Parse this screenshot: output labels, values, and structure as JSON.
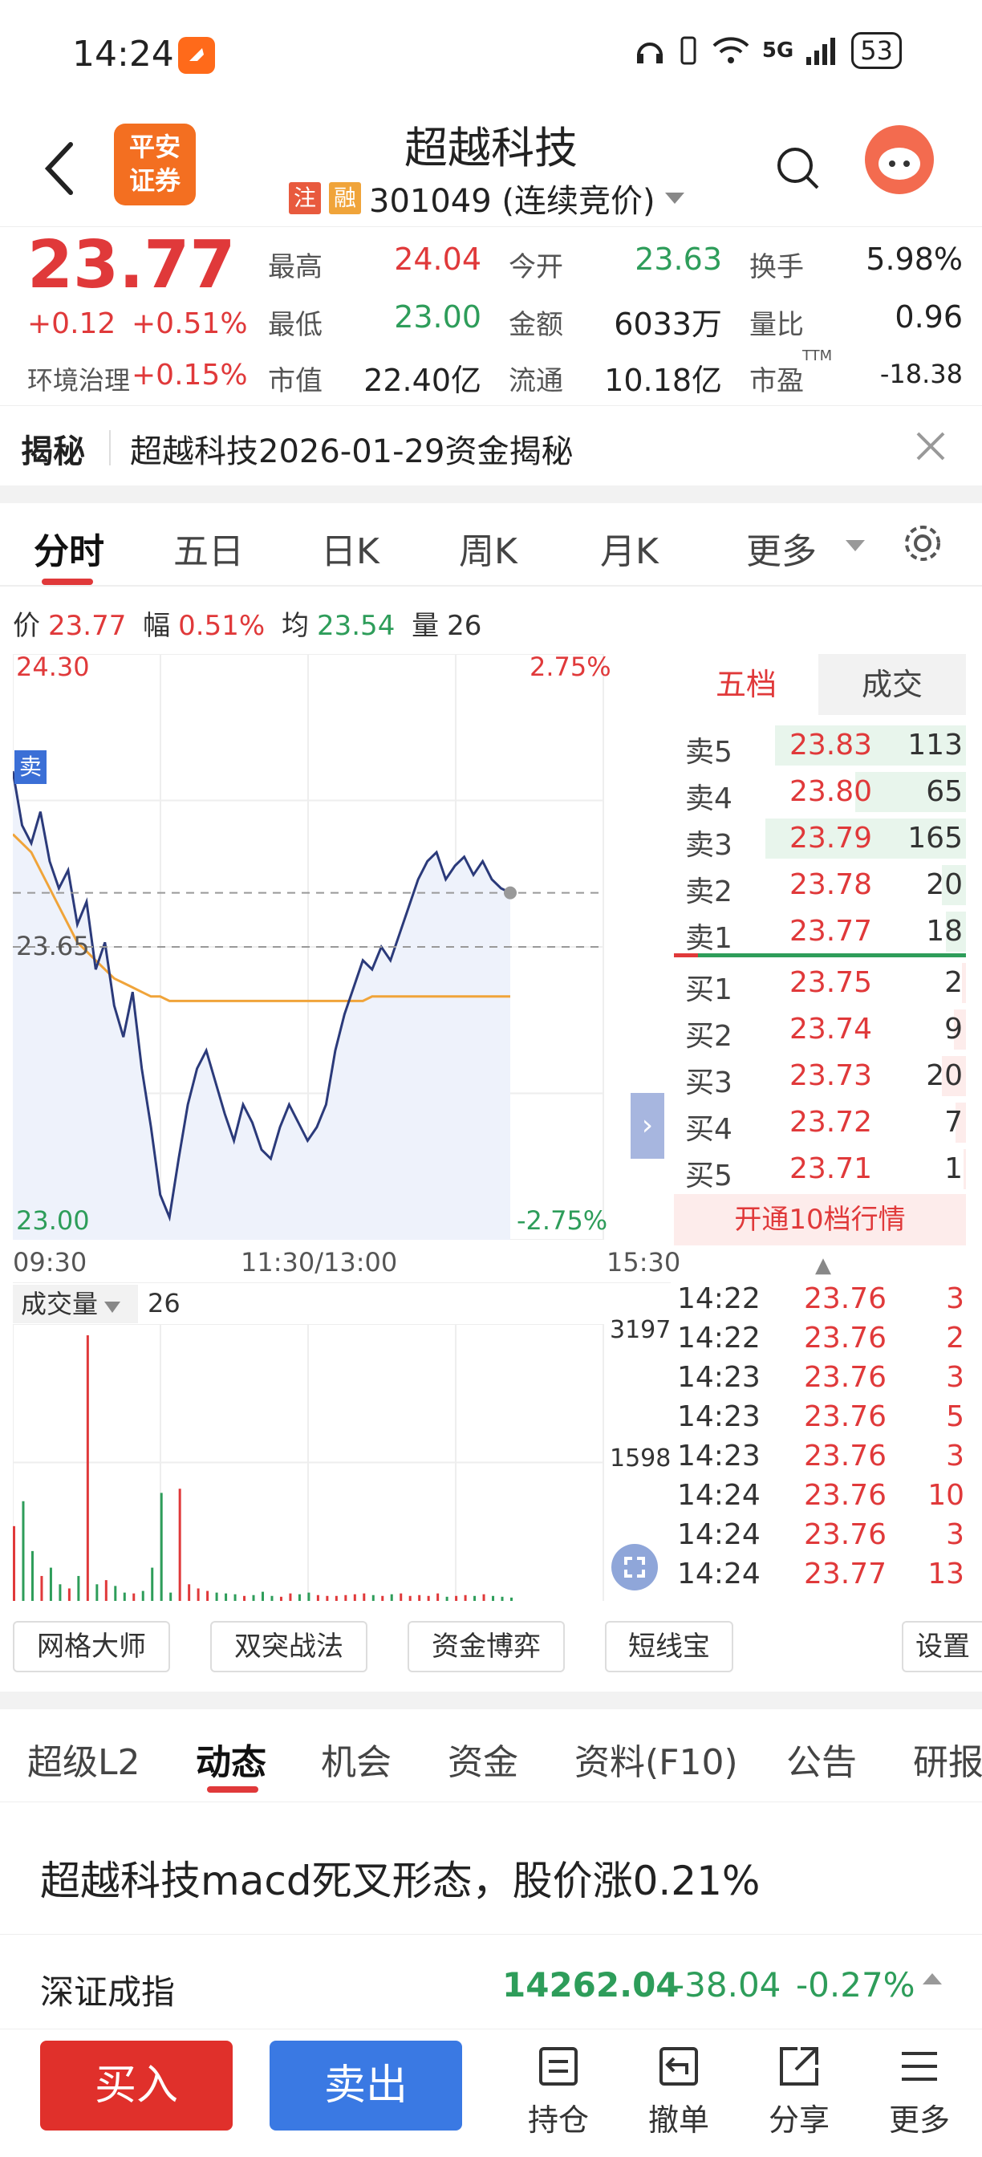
{
  "status": {
    "time": "14:24",
    "network": "5G",
    "battery": "53"
  },
  "header": {
    "title": "超越科技",
    "tag_zhu": "注",
    "tag_rong": "融",
    "code_text": "301049 (连续竞价)",
    "logo_text_1": "平安",
    "logo_text_2": "证券"
  },
  "quote": {
    "price": "23.77",
    "change": "+0.12",
    "change_pct": "+0.51%",
    "sector_name": "环境治理",
    "sector_pct": "+0.15%",
    "high_label": "最高",
    "high": "24.04",
    "open_label": "今开",
    "open": "23.63",
    "turnover_label": "换手",
    "turnover": "5.98%",
    "low_label": "最低",
    "low": "23.00",
    "amount_label": "金额",
    "amount": "6033万",
    "vol_ratio_label": "量比",
    "vol_ratio": "0.96",
    "mktcap_label": "市值",
    "mktcap": "22.40亿",
    "float_label": "流通",
    "float": "10.18亿",
    "pe_label": "市盈",
    "pe_sup": "TTM",
    "pe": "-18.38"
  },
  "reveal": {
    "label": "揭秘",
    "text": "超越科技2026-01-29资金揭秘"
  },
  "chart_tabs": [
    "分时",
    "五日",
    "日K",
    "周K",
    "月K",
    "更多"
  ],
  "info": {
    "price_label": "价",
    "price": "23.77",
    "amp_label": "幅",
    "amp": "0.51%",
    "avg_label": "均",
    "avg": "23.54",
    "vol_label": "量",
    "vol": "26"
  },
  "chart_data": {
    "type": "line",
    "title": "",
    "y_top": "24.30",
    "y_mid": "23.65",
    "y_bottom": "23.00",
    "pct_top": "2.75%",
    "pct_bottom": "-2.75%",
    "ylim": [
      23.0,
      24.3
    ],
    "x_ticks": [
      "09:30",
      "11:30/13:00",
      "15:30"
    ],
    "sell_marker": "卖",
    "series": [
      {
        "values": [
          24.04,
          23.92,
          23.88,
          23.95,
          23.84,
          23.78,
          23.82,
          23.7,
          23.75,
          23.6,
          23.66,
          23.52,
          23.45,
          23.55,
          23.38,
          23.25,
          23.1,
          23.05,
          23.18,
          23.3,
          23.38,
          23.42,
          23.35,
          23.28,
          23.22,
          23.3,
          23.26,
          23.2,
          23.18,
          23.25,
          23.3,
          23.26,
          23.22,
          23.25,
          23.3,
          23.42,
          23.5,
          23.56,
          23.62,
          23.6,
          23.65,
          23.62,
          23.68,
          23.74,
          23.8,
          23.84,
          23.86,
          23.8,
          23.83,
          23.85,
          23.81,
          23.84,
          23.8,
          23.78,
          23.77
        ]
      },
      {
        "values": [
          23.9,
          23.88,
          23.86,
          23.82,
          23.78,
          23.74,
          23.7,
          23.66,
          23.64,
          23.62,
          23.6,
          23.58,
          23.57,
          23.56,
          23.55,
          23.54,
          23.54,
          23.53,
          23.53,
          23.53,
          23.53,
          23.53,
          23.53,
          23.53,
          23.53,
          23.53,
          23.53,
          23.53,
          23.53,
          23.53,
          23.53,
          23.53,
          23.53,
          23.53,
          23.53,
          23.53,
          23.53,
          23.53,
          23.53,
          23.54,
          23.54,
          23.54,
          23.54,
          23.54,
          23.54,
          23.54,
          23.54,
          23.54,
          23.54,
          23.54,
          23.54,
          23.54,
          23.54,
          23.54,
          23.54
        ]
      }
    ],
    "volume_max": "3197",
    "volume_mid": "1598",
    "volume_values": [
      900,
      1200,
      600,
      300,
      400,
      200,
      150,
      300,
      3197,
      200,
      250,
      180,
      100,
      90,
      120,
      400,
      1300,
      100,
      1350,
      200,
      150,
      120,
      100,
      90,
      80,
      60,
      70,
      110,
      60,
      50,
      90,
      80,
      100,
      70,
      60,
      60,
      70,
      80,
      90,
      70,
      60,
      80,
      90,
      60,
      70,
      60,
      90,
      50,
      60,
      70,
      60,
      80,
      60,
      50,
      40
    ]
  },
  "orderbook": {
    "tab_5": "五档",
    "tab_trades": "成交",
    "asks": [
      {
        "label": "卖5",
        "price": "23.83",
        "vol": "113",
        "bar": 0.95
      },
      {
        "label": "卖4",
        "price": "23.80",
        "vol": "65",
        "bar": 0.55
      },
      {
        "label": "卖3",
        "price": "23.79",
        "vol": "165",
        "bar": 1.0
      },
      {
        "label": "卖2",
        "price": "23.78",
        "vol": "20",
        "bar": 0.12
      },
      {
        "label": "卖1",
        "price": "23.77",
        "vol": "18",
        "bar": 0.1
      }
    ],
    "bids": [
      {
        "label": "买1",
        "price": "23.75",
        "vol": "2",
        "bar": 0.02
      },
      {
        "label": "买2",
        "price": "23.74",
        "vol": "9",
        "bar": 0.06
      },
      {
        "label": "买3",
        "price": "23.73",
        "vol": "20",
        "bar": 0.12
      },
      {
        "label": "买4",
        "price": "23.72",
        "vol": "7",
        "bar": 0.05
      },
      {
        "label": "买5",
        "price": "23.71",
        "vol": "1",
        "bar": 0.01
      }
    ],
    "open10": "开通10档行情"
  },
  "volume_header": {
    "label": "成交量",
    "value": "26"
  },
  "ticks": [
    {
      "time": "14:22",
      "price": "23.76",
      "vol": "3"
    },
    {
      "time": "14:22",
      "price": "23.76",
      "vol": "2"
    },
    {
      "time": "14:23",
      "price": "23.76",
      "vol": "3"
    },
    {
      "time": "14:23",
      "price": "23.76",
      "vol": "5"
    },
    {
      "time": "14:23",
      "price": "23.76",
      "vol": "3"
    },
    {
      "time": "14:24",
      "price": "23.76",
      "vol": "10"
    },
    {
      "time": "14:24",
      "price": "23.76",
      "vol": "3"
    },
    {
      "time": "14:24",
      "price": "23.77",
      "vol": "13"
    }
  ],
  "tools": [
    "网格大师",
    "双突战法",
    "资金博弈",
    "短线宝",
    "设置"
  ],
  "bottom_tabs": [
    "超级L2",
    "动态",
    "机会",
    "资金",
    "资料(F10)",
    "公告",
    "研报"
  ],
  "news": {
    "title": "超越科技macd死叉形态，股价涨0.21%"
  },
  "index": {
    "name": "深证成指",
    "value": "14262.04",
    "change": "-38.04",
    "pct": "-0.27%"
  },
  "bottom_bar": {
    "buy": "买入",
    "sell": "卖出",
    "hold": "持仓",
    "cancel": "撤单",
    "share": "分享",
    "more": "更多"
  },
  "colors": {
    "up": "#e0393a",
    "down": "#2e9d5a",
    "price_line": "#2b3a7a",
    "avg_line": "#f0a43a",
    "buy": "#e0302b",
    "sell": "#3a79e3"
  }
}
